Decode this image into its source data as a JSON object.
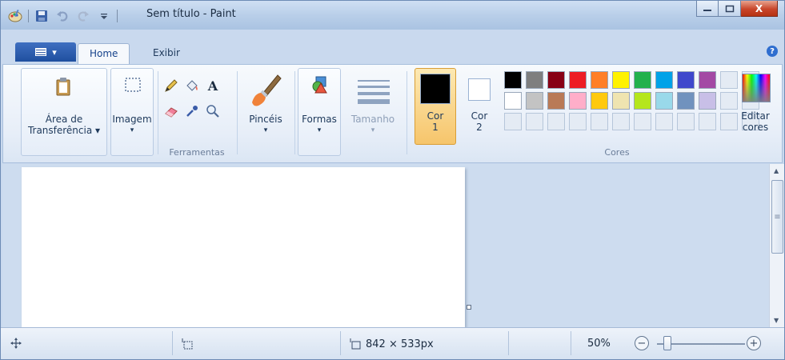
{
  "window": {
    "title": "Sem título - Paint",
    "close_glyph": "X"
  },
  "tabs": {
    "home": "Home",
    "view": "Exibir",
    "help": "?"
  },
  "ribbon": {
    "clipboard": {
      "label_line1": "Área de",
      "label_line2": "Transferência ▾"
    },
    "image": {
      "label": "Imagem",
      "arrow": "▾"
    },
    "tools": {
      "group_label": "Ferramentas",
      "text_glyph": "A"
    },
    "brushes": {
      "label": "Pincéis",
      "arrow": "▾"
    },
    "shapes": {
      "label": "Formas",
      "arrow": "▾"
    },
    "size": {
      "label": "Tamanho",
      "arrow": "▾"
    },
    "color1": {
      "line1": "Cor",
      "line2": "1",
      "color": "#000000"
    },
    "color2": {
      "line1": "Cor",
      "line2": "2",
      "color": "#ffffff"
    },
    "colors": {
      "group_label": "Cores"
    },
    "edit_colors": {
      "line1": "Editar",
      "line2": "cores"
    }
  },
  "palette_row1": [
    "#000000",
    "#7f7f7f",
    "#880015",
    "#ed1c24",
    "#ff7f27",
    "#fff200",
    "#22b14c",
    "#00a2e8",
    "#3f48cc",
    "#a349a4"
  ],
  "palette_row2": [
    "#ffffff",
    "#c3c3c3",
    "#b97a57",
    "#ffaec9",
    "#ffc90e",
    "#efe4b0",
    "#b5e61d",
    "#99d9ea",
    "#7092be",
    "#c8bfe7"
  ],
  "status": {
    "canvas_size": "842 × 533px",
    "zoom": "50%"
  }
}
